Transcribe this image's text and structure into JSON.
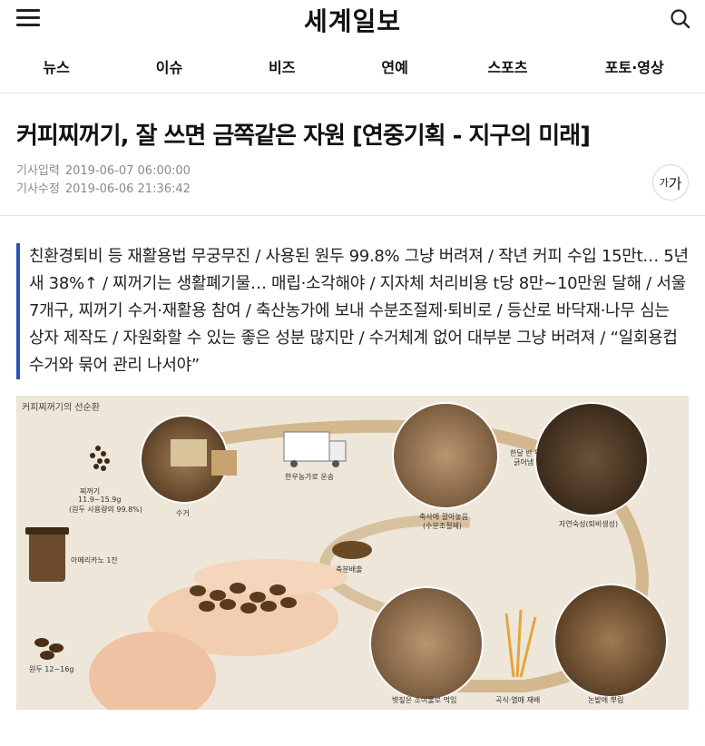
{
  "header": {
    "logo": "세계일보",
    "menu_icon": "hamburger-menu-icon",
    "search_icon": "search-icon"
  },
  "nav": [
    "뉴스",
    "이슈",
    "비즈",
    "연예",
    "스포츠",
    "포토·영상"
  ],
  "article": {
    "headline": "커피찌꺼기, 잘 쓰면 금쪽같은 자원 [연중기획 - 지구의 미래]",
    "published_label": "기사입력",
    "published": "2019-06-07 06:00:00",
    "modified_label": "기사수정",
    "modified": "2019-06-06 21:36:42",
    "font_button_small": "가",
    "font_button_big": "가",
    "summary": "친환경퇴비 등 재활용법 무궁무진 / 사용된 원두 99.8% 그냥 버려져 / 작년 커피 수입 15만t… 5년새 38%↑ / 찌꺼기는 생활폐기물… 매립·소각해야 / 지자체 처리비용 t당 8만~10만원 달해 / 서울 7개구, 찌꺼기 수거·재활용 참여 / 축산농가에 보내 수분조절제·퇴비로 / 등산로 바닥재·나무 심는 상자 제작도 / 자원화할 수 있는 좋은 성분 많지만 / 수거체계 없어 대부분 그냥 버려져 / “일회용컵 수거와 묶어 관리 나서야”"
  },
  "infographic": {
    "title": "커피찌꺼기의 선순환",
    "grounds_label": "찌꺼기",
    "grounds_amount": "11.9~15.9g",
    "grounds_note": "(원두 사용량의 99.8%)",
    "collect": "수거",
    "transport": "한우농가로 운송",
    "barn": "축사에 깔아놓음",
    "barn_note": "(수분조절제)",
    "wait": "한달 반 뒤",
    "wait2": "긁어냄",
    "compost": "자연숙성(퇴비생성)",
    "americano": "아메리카노 1잔",
    "manure": "축분배출",
    "beans": "원두 12~16g",
    "feed": "볏짚은 소여물로 먹임",
    "grain": "곡식·열매 재배",
    "field": "논밭에 뿌림",
    "colors": {
      "arrow": "#c9a876",
      "background": "#ede6d9"
    }
  },
  "colors": {
    "accent_bar": "#2a54b8",
    "meta_text": "#8a8a8a"
  }
}
